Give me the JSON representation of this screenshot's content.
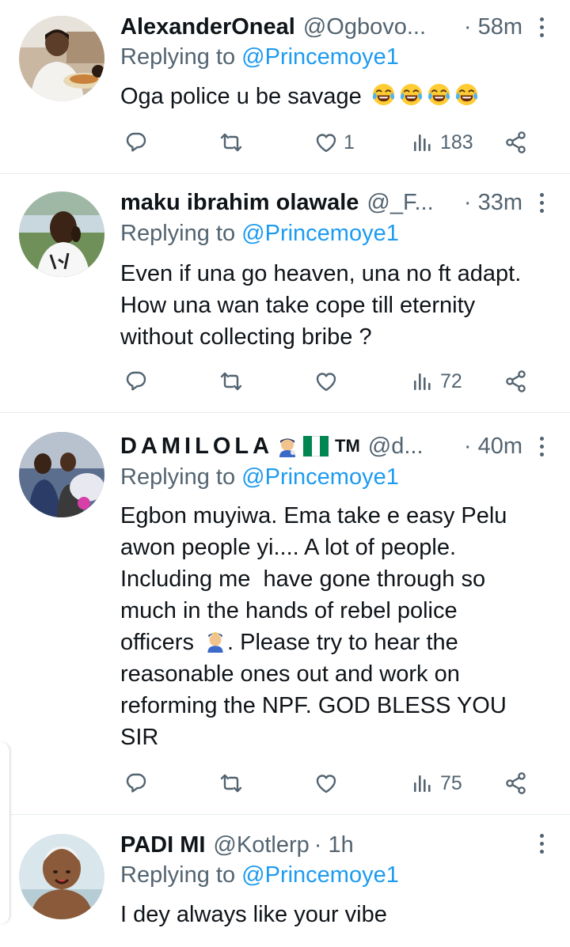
{
  "colors": {
    "accent": "#1d9bf0",
    "muted": "#536471",
    "text": "#0f1419",
    "divider": "#e6ecf0"
  },
  "icons": [
    "reply-icon",
    "retweet-icon",
    "like-icon",
    "views-icon",
    "share-icon",
    "more-icon",
    "laughing-crying-emoji",
    "nigeria-flag",
    "police-officer-emoji"
  ],
  "tweets": [
    {
      "name": "AlexanderOneal",
      "handle": "@Ogbovo...",
      "time": "· 58m",
      "reply_label": "Replying to",
      "reply_to": "@Princemoye1",
      "text": "Oga police u be savage",
      "emoji": "😂😂😂😂",
      "likes": "1",
      "views": "183"
    },
    {
      "name": "maku ibrahim olawale",
      "handle": "@_F...",
      "time": "· 33m",
      "reply_label": "Replying to",
      "reply_to": "@Princemoye1",
      "text": "Even if una go heaven, una no ft adapt.\nHow una wan take cope till eternity\nwithout collecting bribe ?",
      "likes": "",
      "views": "72"
    },
    {
      "name": "DAMILOLA",
      "name_suffix": "TM",
      "handle": "@d...",
      "time": "· 40m",
      "reply_label": "Replying to",
      "reply_to": "@Princemoye1",
      "text_a": "Egbon muyiwa. Ema take e easy Pelu\nawon people yi.... A lot of people.\nIncluding me  have gone through so\nmuch in the hands of rebel police\nofficers",
      "text_b": ". Please try to hear the\nreasonable ones out and work on\nreforming the NPF. GOD BLESS YOU\nSIR",
      "likes": "",
      "views": "75"
    },
    {
      "name": "PADI MI",
      "handle": "@Kotlerp",
      "time": "· 1h",
      "reply_label": "Replying to",
      "reply_to": "@Princemoye1",
      "text": "I dey always like your vibe"
    }
  ]
}
